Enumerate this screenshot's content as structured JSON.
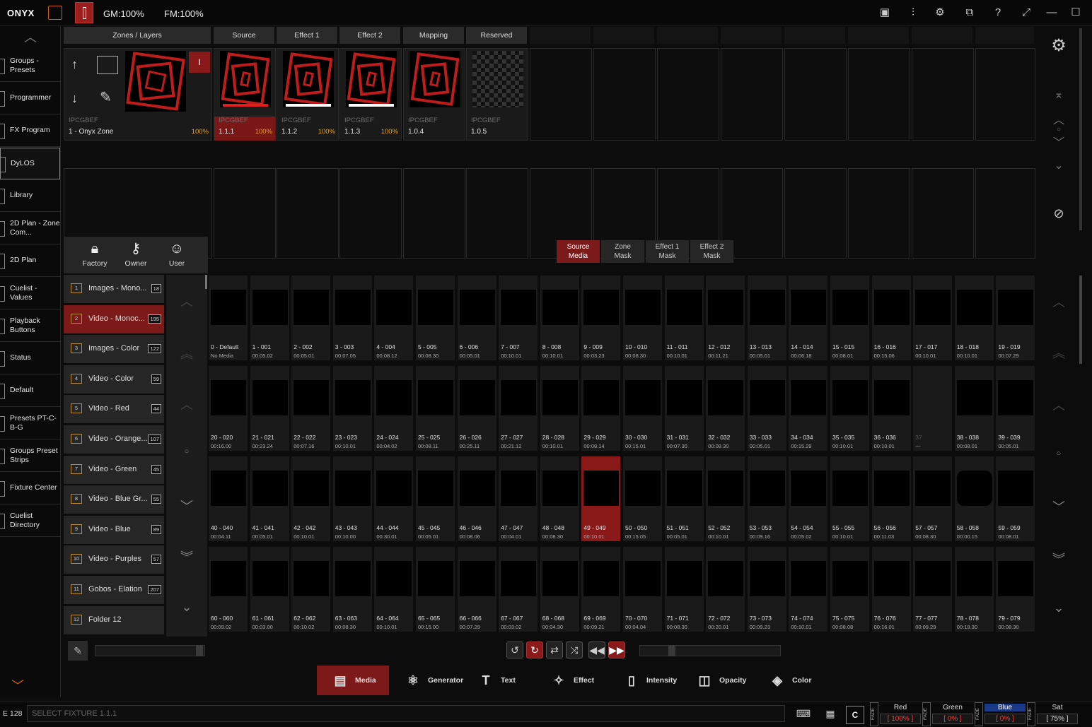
{
  "topbar": {
    "logo": "ONYX",
    "gm": "GM:100%",
    "fm": "FM:100%"
  },
  "sidebar": {
    "items": [
      {
        "label": "Groups - Presets"
      },
      {
        "label": "Programmer"
      },
      {
        "label": "FX Program"
      },
      {
        "label": "DyLOS",
        "selected": true
      },
      {
        "label": "Library"
      },
      {
        "label": "2D Plan - Zone Com..."
      },
      {
        "label": "2D Plan"
      },
      {
        "label": "Cuelist - Values"
      },
      {
        "label": "Playback Buttons"
      },
      {
        "label": "Status"
      },
      {
        "label": "Default"
      },
      {
        "label": "Presets PT-C-B-G"
      },
      {
        "label": "Groups Preset Strips"
      },
      {
        "label": "Fixture Center"
      },
      {
        "label": "Cuelist Directory"
      }
    ]
  },
  "zones": {
    "headers": [
      "Zones / Layers",
      "Source",
      "Effect 1",
      "Effect 2",
      "Mapping",
      "Reserved"
    ],
    "cells": [
      {
        "code": "IPCGBEF",
        "name": "1 - Onyx Zone",
        "pct": "100%"
      },
      {
        "code": "IPCGBEF",
        "name": "1.1.1",
        "pct": "100%"
      },
      {
        "code": "IPCGBEF",
        "name": "1.1.2",
        "pct": "100%"
      },
      {
        "code": "IPCGBEF",
        "name": "1.1.3",
        "pct": "100%"
      },
      {
        "code": "IPCGBEF",
        "name": "1.0.4",
        "pct": ""
      },
      {
        "code": "IPCGBEF",
        "name": "1.0.5",
        "pct": ""
      }
    ]
  },
  "filters": {
    "factory": "Factory",
    "owner": "Owner",
    "user": "User"
  },
  "folders": [
    {
      "num": "1",
      "name": "Images - Mono...",
      "count": "18"
    },
    {
      "num": "2",
      "name": "Video - Monoc...",
      "count": "195",
      "selected": true
    },
    {
      "num": "3",
      "name": "Images - Color",
      "count": "122"
    },
    {
      "num": "4",
      "name": "Video - Color",
      "count": "59"
    },
    {
      "num": "5",
      "name": "Video - Red",
      "count": "44"
    },
    {
      "num": "6",
      "name": "Video - Orange...",
      "count": "107"
    },
    {
      "num": "7",
      "name": "Video - Green",
      "count": "45"
    },
    {
      "num": "8",
      "name": "Video - Blue Gr...",
      "count": "55"
    },
    {
      "num": "9",
      "name": "Video - Blue",
      "count": "89"
    },
    {
      "num": "10",
      "name": "Video - Purples",
      "count": "57"
    },
    {
      "num": "11",
      "name": "Gobos - Elation",
      "count": "207"
    },
    {
      "num": "12",
      "name": "Folder 12",
      "count": ""
    }
  ],
  "media_tabs": [
    {
      "line1": "Source",
      "line2": "Media",
      "selected": true
    },
    {
      "line1": "Zone",
      "line2": "Mask"
    },
    {
      "line1": "Effect 1",
      "line2": "Mask"
    },
    {
      "line1": "Effect 2",
      "line2": "Mask"
    }
  ],
  "media": [
    {
      "n": "0 - Default",
      "d": "No Media",
      "p": "none"
    },
    {
      "n": "1 - 001",
      "d": "00:05.02",
      "p": "swirl"
    },
    {
      "n": "2 - 002",
      "d": "00:05.01",
      "p": "dots"
    },
    {
      "n": "3 - 003",
      "d": "00:07.05",
      "p": "checker"
    },
    {
      "n": "4 - 004",
      "d": "00:08.12",
      "p": "noise"
    },
    {
      "n": "5 - 005",
      "d": "00:08.30",
      "p": "dots"
    },
    {
      "n": "6 - 006",
      "d": "00:05.01",
      "p": "radial"
    },
    {
      "n": "7 - 007",
      "d": "00:10.01",
      "p": "swirl"
    },
    {
      "n": "8 - 008",
      "d": "00:10.01",
      "p": "lines"
    },
    {
      "n": "9 - 009",
      "d": "00:03.23",
      "p": "star"
    },
    {
      "n": "10 - 010",
      "d": "00:08.30",
      "p": "grad"
    },
    {
      "n": "11 - 011",
      "d": "00:10.01",
      "p": "vlines"
    },
    {
      "n": "12 - 012",
      "d": "00:11.21",
      "p": "noise"
    },
    {
      "n": "13 - 013",
      "d": "00:05.01",
      "p": "noise"
    },
    {
      "n": "14 - 014",
      "d": "00:06.18",
      "p": "star"
    },
    {
      "n": "15 - 015",
      "d": "00:08.01",
      "p": "rings"
    },
    {
      "n": "16 - 016",
      "d": "00:15.06",
      "p": "noise"
    },
    {
      "n": "17 - 017",
      "d": "00:10.01",
      "p": "cloud"
    },
    {
      "n": "18 - 018",
      "d": "00:10.01",
      "p": "grid"
    },
    {
      "n": "19 - 019",
      "d": "00:07.29",
      "p": "dots"
    },
    {
      "n": "20 - 020",
      "d": "00:16.00",
      "p": "road"
    },
    {
      "n": "21 - 021",
      "d": "00:23.24",
      "p": "dots"
    },
    {
      "n": "22 - 022",
      "d": "00:07.16",
      "p": "gold"
    },
    {
      "n": "23 - 023",
      "d": "00:10.01",
      "p": "swirl"
    },
    {
      "n": "24 - 024",
      "d": "00:04.02",
      "p": "star"
    },
    {
      "n": "25 - 025",
      "d": "00:08.11",
      "p": "zigzag"
    },
    {
      "n": "26 - 026",
      "d": "00:25.11",
      "p": "none"
    },
    {
      "n": "27 - 027",
      "d": "00:21.12",
      "p": "dots"
    },
    {
      "n": "28 - 028",
      "d": "00:10.01",
      "p": "swirl"
    },
    {
      "n": "29 - 029",
      "d": "00:08.14",
      "p": "noise"
    },
    {
      "n": "30 - 030",
      "d": "00:15.01",
      "p": "purple"
    },
    {
      "n": "31 - 031",
      "d": "00:07.30",
      "p": "rings"
    },
    {
      "n": "32 - 032",
      "d": "00:08.30",
      "p": "zigzag"
    },
    {
      "n": "33 - 033",
      "d": "00:05.01",
      "p": "diag"
    },
    {
      "n": "34 - 034",
      "d": "00:15.29",
      "p": "vlines"
    },
    {
      "n": "35 - 035",
      "d": "00:10.01",
      "p": "bar3"
    },
    {
      "n": "36 - 036",
      "d": "00:10.01",
      "p": "none"
    },
    {
      "n": "37",
      "d": "---",
      "p": "none",
      "empty": true
    },
    {
      "n": "38 - 038",
      "d": "00:08.01",
      "p": "sun"
    },
    {
      "n": "39 - 039",
      "d": "00:05.01",
      "p": "vlines"
    },
    {
      "n": "40 - 040",
      "d": "00:04.11",
      "p": "cloud"
    },
    {
      "n": "41 - 041",
      "d": "00:05.01",
      "p": "noise"
    },
    {
      "n": "42 - 042",
      "d": "00:10.01",
      "p": "lines"
    },
    {
      "n": "43 - 043",
      "d": "00:10.00",
      "p": "none"
    },
    {
      "n": "44 - 044",
      "d": "00:30.01",
      "p": "diag"
    },
    {
      "n": "45 - 045",
      "d": "00:05.01",
      "p": "noise"
    },
    {
      "n": "46 - 046",
      "d": "00:08.06",
      "p": "cloud"
    },
    {
      "n": "47 - 047",
      "d": "00:04.01",
      "p": "cloud"
    },
    {
      "n": "48 - 048",
      "d": "00:08.30",
      "p": "dots"
    },
    {
      "n": "49 - 049",
      "d": "00:10.01",
      "p": "swirl",
      "selected": true
    },
    {
      "n": "50 - 050",
      "d": "00:15.05",
      "p": "blue"
    },
    {
      "n": "51 - 051",
      "d": "00:05.01",
      "p": "none"
    },
    {
      "n": "52 - 052",
      "d": "00:10.01",
      "p": "grad"
    },
    {
      "n": "53 - 053",
      "d": "00:09.16",
      "p": "dots"
    },
    {
      "n": "54 - 054",
      "d": "00:05.02",
      "p": "star"
    },
    {
      "n": "55 - 055",
      "d": "00:10.01",
      "p": "checker"
    },
    {
      "n": "56 - 056",
      "d": "00:11.03",
      "p": "brown"
    },
    {
      "n": "57 - 057",
      "d": "00:08.30",
      "p": "dots"
    },
    {
      "n": "58 - 058",
      "d": "00:00.15",
      "p": "white"
    },
    {
      "n": "59 - 059",
      "d": "00:08.01",
      "p": "fan"
    },
    {
      "n": "60 - 060",
      "d": "00:09.02",
      "p": "noise"
    },
    {
      "n": "61 - 061",
      "d": "00:03.00",
      "p": "tunnel"
    },
    {
      "n": "62 - 062",
      "d": "00:10.02",
      "p": "grid"
    },
    {
      "n": "63 - 063",
      "d": "00:08.30",
      "p": "noise"
    },
    {
      "n": "64 - 064",
      "d": "00:10.01",
      "p": "checker"
    },
    {
      "n": "65 - 065",
      "d": "00:15.00",
      "p": "diag"
    },
    {
      "n": "66 - 066",
      "d": "00:07.29",
      "p": "zigzag"
    },
    {
      "n": "67 - 067",
      "d": "00:03.02",
      "p": "swirl"
    },
    {
      "n": "68 - 068",
      "d": "00:04.30",
      "p": "swirl"
    },
    {
      "n": "69 - 069",
      "d": "00:09.21",
      "p": "dots"
    },
    {
      "n": "70 - 070",
      "d": "00:04.04",
      "p": "rings"
    },
    {
      "n": "71 - 071",
      "d": "00:08.30",
      "p": "zigzag"
    },
    {
      "n": "72 - 072",
      "d": "00:20.01",
      "p": "tunnel"
    },
    {
      "n": "73 - 073",
      "d": "00:09.23",
      "p": "fan"
    },
    {
      "n": "74 - 074",
      "d": "00:10.01",
      "p": "none"
    },
    {
      "n": "75 - 075",
      "d": "00:08.08",
      "p": "diag"
    },
    {
      "n": "76 - 076",
      "d": "00:16.01",
      "p": "circle"
    },
    {
      "n": "77 - 077",
      "d": "00:09.29",
      "p": "hstripe"
    },
    {
      "n": "78 - 078",
      "d": "00:19.30",
      "p": "stripes"
    },
    {
      "n": "79 - 079",
      "d": "00:08.30",
      "p": "bars"
    }
  ],
  "bottom_tabs": [
    {
      "label": "Media",
      "icon": "media-icon",
      "selected": true
    },
    {
      "label": "Generator",
      "icon": "generator-icon"
    },
    {
      "label": "Text",
      "icon": "text-icon"
    },
    {
      "label": "Effect",
      "icon": "effect-icon"
    },
    {
      "label": "Intensity",
      "icon": "intensity-icon"
    },
    {
      "label": "Opacity",
      "icon": "opacity-icon"
    },
    {
      "label": "Color",
      "icon": "color-icon"
    }
  ],
  "status": {
    "label": "E 128",
    "command": "SELECT FIXTURE 1.1.1",
    "c_button": "C",
    "fades": [
      {
        "tag": "FADE",
        "name": "Red",
        "value": "[ 100% ]"
      },
      {
        "tag": "FADE",
        "name": "Green",
        "value": "[ 0% ]"
      },
      {
        "tag": "FADE",
        "name": "Blue",
        "value": "[ 0% ]",
        "active": true
      },
      {
        "tag": "FADE",
        "name": "Sat",
        "value": "[ 75% ]"
      }
    ]
  },
  "colors": {
    "accent_red": "#7c1a1a",
    "orange": "#e8a020",
    "blue_active": "#1a3a88"
  }
}
